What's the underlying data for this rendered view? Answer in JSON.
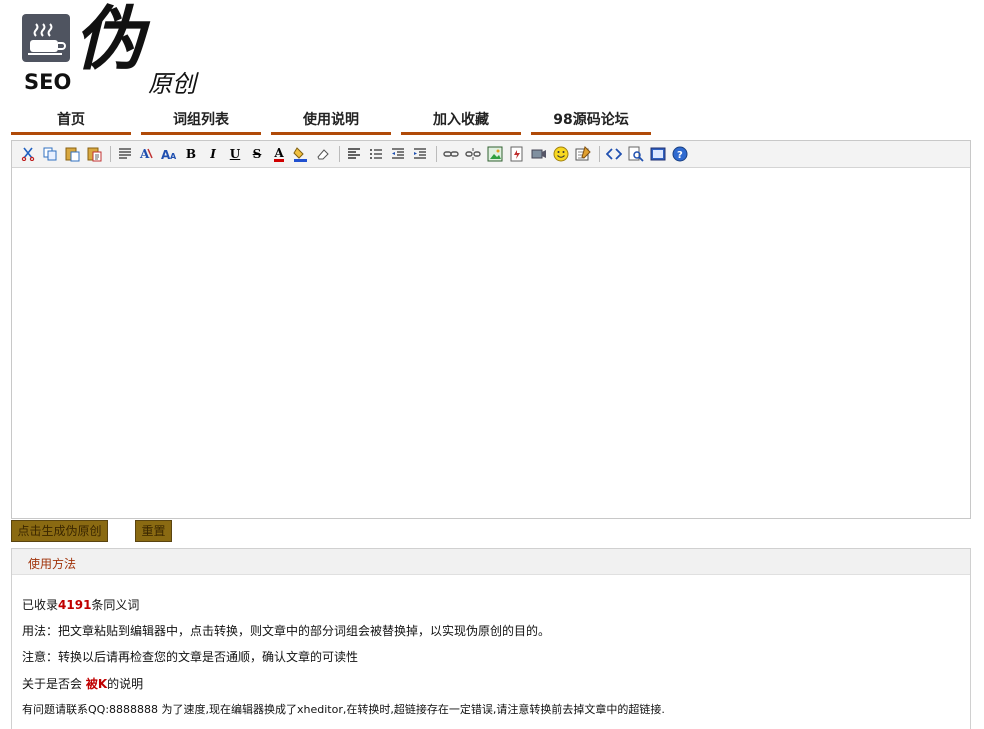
{
  "logo": {
    "seo_text": "SEO",
    "main_glyph": "伪",
    "sub_glyph": "原创"
  },
  "nav": {
    "tabs": [
      {
        "label": "首页"
      },
      {
        "label": "词组列表"
      },
      {
        "label": "使用说明"
      },
      {
        "label": "加入收藏"
      },
      {
        "label": "98源码论坛"
      }
    ]
  },
  "toolbar": {
    "icons": [
      "cut-icon",
      "copy-icon",
      "paste-icon",
      "paste-text-icon",
      "block-format-icon",
      "font-family-icon",
      "font-size-icon",
      "bold-icon",
      "italic-icon",
      "underline-icon",
      "strikethrough-icon",
      "font-color-icon",
      "background-color-icon",
      "remove-format-icon",
      "align-icon",
      "list-icon",
      "outdent-icon",
      "indent-icon",
      "link-icon",
      "unlink-icon",
      "image-icon",
      "flash-icon",
      "media-icon",
      "emoticon-icon",
      "table-icon",
      "source-icon",
      "preview-icon",
      "fullscreen-icon",
      "about-icon"
    ],
    "labels": {
      "bold": "B",
      "italic": "I",
      "underline": "U",
      "strike": "S",
      "font_color": "A",
      "font_size": "A"
    }
  },
  "buttons": {
    "generate": "点击生成伪原创",
    "reset": "重置"
  },
  "usage": {
    "title": "使用方法",
    "count_prefix": "已收录",
    "count": "4191",
    "count_suffix": "条同义词",
    "usage_line": "用法：把文章粘贴到编辑器中，点击转换，则文章中的部分词组会被替换掉，以实现伪原创的目的。",
    "note_line": "注意：转换以后请再检查您的文章是否通顺，确认文章的可读性",
    "k_prefix": "关于是否会 ",
    "k_strong": "被K",
    "k_suffix": "的说明",
    "contact_line": "有问题请联系QQ:8888888 为了速度,现在编辑器换成了xheditor,在转换时,超链接存在一定错误,请注意转换前去掉文章中的超链接."
  },
  "colors": {
    "accent": "#b04a08",
    "button_bg": "#8a6a12",
    "highlight_red": "#c00000"
  }
}
